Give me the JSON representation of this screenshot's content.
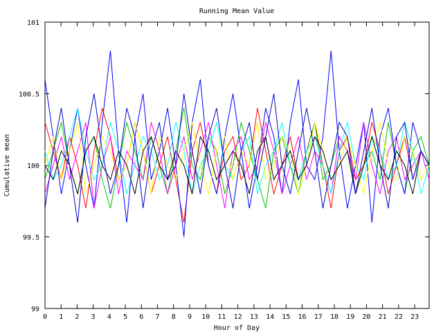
{
  "chart_data": {
    "type": "line",
    "title": "Running Mean Value",
    "xlabel": "Hour of Day",
    "ylabel": "Cumulative mean",
    "xlim": [
      0,
      23.9
    ],
    "ylim": [
      99,
      101
    ],
    "x_ticks": [
      0,
      1,
      2,
      3,
      4,
      5,
      6,
      7,
      8,
      9,
      10,
      11,
      12,
      13,
      14,
      15,
      16,
      17,
      18,
      19,
      20,
      21,
      22,
      23
    ],
    "x_tick_labels": [
      "0",
      "1",
      "2",
      "3",
      "4",
      "5",
      "6",
      "7",
      "8",
      "9",
      "10",
      "11",
      "12",
      "13",
      "14",
      "15",
      "16",
      "17",
      "18",
      "19",
      "20",
      "21",
      "22",
      "23"
    ],
    "y_ticks": [
      99,
      99.5,
      100,
      100.5,
      101
    ],
    "y_tick_labels": [
      "99",
      "99.5",
      "100",
      "100.5",
      "101"
    ],
    "grid": true,
    "legend": "none",
    "series_colors": [
      "#ff0000",
      "#00c000",
      "#0000ff",
      "#ff00ff",
      "#00ffff",
      "#ffff00",
      "#000000",
      "#0000c0"
    ],
    "series": [
      {
        "color": "#ff0000",
        "values": [
          100.3,
          100.1,
          99.9,
          100.2,
          100.0,
          99.7,
          100.1,
          100.4,
          100.2,
          99.9,
          100.0,
          100.3,
          100.1,
          99.8,
          100.0,
          100.2,
          99.9,
          99.6,
          100.1,
          100.3,
          100.0,
          99.8,
          100.1,
          100.2,
          99.9,
          100.0,
          100.4,
          100.1,
          99.8,
          100.0,
          100.2,
          99.9,
          100.1,
          100.3,
          100.0,
          99.7,
          100.1,
          100.2,
          99.9,
          100.0,
          100.3,
          100.1,
          99.8,
          100.0,
          100.2,
          99.9,
          100.1,
          100.0
        ]
      },
      {
        "color": "#00c000",
        "values": [
          99.9,
          100.1,
          100.3,
          100.0,
          99.8,
          100.1,
          100.2,
          99.9,
          99.7,
          100.0,
          100.3,
          100.1,
          99.9,
          100.2,
          100.0,
          99.8,
          100.1,
          100.4,
          100.0,
          99.9,
          100.2,
          100.1,
          99.8,
          100.0,
          100.3,
          100.1,
          99.9,
          99.7,
          100.1,
          100.2,
          100.0,
          99.8,
          100.1,
          100.3,
          99.9,
          100.0,
          100.2,
          100.1,
          99.8,
          100.0,
          100.1,
          99.9,
          100.3,
          100.0,
          99.8,
          100.1,
          100.2,
          100.0
        ]
      },
      {
        "color": "#0000ff",
        "values": [
          100.6,
          100.2,
          99.8,
          100.1,
          100.4,
          100.0,
          99.7,
          100.3,
          100.8,
          100.1,
          99.6,
          100.2,
          100.5,
          99.9,
          100.1,
          100.4,
          100.0,
          99.5,
          100.3,
          100.6,
          100.0,
          99.8,
          100.2,
          100.5,
          100.1,
          99.7,
          100.0,
          100.4,
          100.2,
          99.8,
          100.3,
          100.6,
          100.0,
          99.9,
          100.2,
          100.8,
          100.1,
          99.7,
          100.0,
          100.3,
          99.6,
          100.2,
          100.4,
          100.0,
          99.8,
          100.3,
          100.1,
          100.0
        ]
      },
      {
        "color": "#ff00ff",
        "values": [
          99.8,
          100.0,
          100.2,
          99.9,
          100.1,
          100.3,
          99.7,
          100.0,
          100.2,
          99.8,
          100.1,
          100.0,
          99.9,
          100.3,
          100.1,
          99.8,
          100.0,
          100.2,
          99.9,
          100.1,
          100.3,
          100.0,
          99.7,
          100.1,
          100.2,
          99.9,
          100.0,
          100.3,
          100.1,
          99.8,
          100.0,
          100.2,
          99.9,
          100.1,
          100.0,
          99.8,
          100.2,
          100.1,
          99.9,
          100.3,
          100.0,
          99.8,
          100.1,
          100.2,
          99.9,
          100.0,
          100.1,
          99.9
        ]
      },
      {
        "color": "#00ffff",
        "values": [
          100.1,
          99.9,
          100.0,
          100.2,
          100.4,
          100.1,
          99.9,
          100.0,
          100.3,
          100.1,
          99.8,
          100.0,
          100.2,
          100.1,
          99.9,
          100.0,
          100.3,
          100.1,
          99.8,
          100.0,
          100.1,
          100.3,
          100.0,
          99.9,
          100.1,
          100.2,
          99.8,
          100.0,
          100.1,
          100.3,
          100.0,
          99.9,
          100.1,
          100.2,
          100.0,
          99.8,
          100.1,
          100.3,
          100.0,
          99.9,
          100.2,
          100.1,
          99.9,
          100.0,
          100.3,
          100.1,
          99.8,
          100.0
        ]
      },
      {
        "color": "#ffff00",
        "values": [
          100.0,
          100.2,
          99.9,
          100.1,
          100.3,
          99.8,
          100.0,
          100.2,
          100.1,
          99.9,
          100.0,
          100.3,
          100.1,
          99.8,
          100.2,
          100.0,
          99.9,
          100.1,
          100.3,
          100.0,
          99.8,
          100.1,
          100.2,
          99.9,
          100.1,
          100.0,
          100.3,
          99.9,
          100.0,
          100.2,
          100.1,
          99.8,
          100.0,
          100.3,
          100.1,
          99.9,
          100.0,
          100.2,
          100.0,
          99.8,
          100.1,
          100.3,
          100.0,
          99.9,
          100.2,
          100.1,
          99.9,
          100.0
        ]
      },
      {
        "color": "#000000",
        "values": [
          100.0,
          99.9,
          100.1,
          100.0,
          99.8,
          100.1,
          100.2,
          100.0,
          99.9,
          100.1,
          100.0,
          99.8,
          100.1,
          100.2,
          100.0,
          99.9,
          100.1,
          100.0,
          99.8,
          100.2,
          100.1,
          99.9,
          100.0,
          100.1,
          100.0,
          99.8,
          100.1,
          100.2,
          99.9,
          100.0,
          100.1,
          99.9,
          100.0,
          100.2,
          100.1,
          99.9,
          100.0,
          100.1,
          99.8,
          100.0,
          100.2,
          100.0,
          99.9,
          100.1,
          100.0,
          99.8,
          100.1,
          100.0
        ]
      },
      {
        "color": "#0000c0",
        "values": [
          99.7,
          100.1,
          100.4,
          100.0,
          99.6,
          100.2,
          100.5,
          100.1,
          99.8,
          100.0,
          100.4,
          100.2,
          99.7,
          100.1,
          100.3,
          99.9,
          100.0,
          100.5,
          100.1,
          99.8,
          100.2,
          100.4,
          100.0,
          99.7,
          100.1,
          100.3,
          99.9,
          100.2,
          100.5,
          100.0,
          99.8,
          100.1,
          100.4,
          100.1,
          99.7,
          100.0,
          100.3,
          100.2,
          99.8,
          100.1,
          100.4,
          100.0,
          99.7,
          100.2,
          100.3,
          99.9,
          100.1,
          100.0
        ]
      }
    ],
    "annotations": []
  }
}
